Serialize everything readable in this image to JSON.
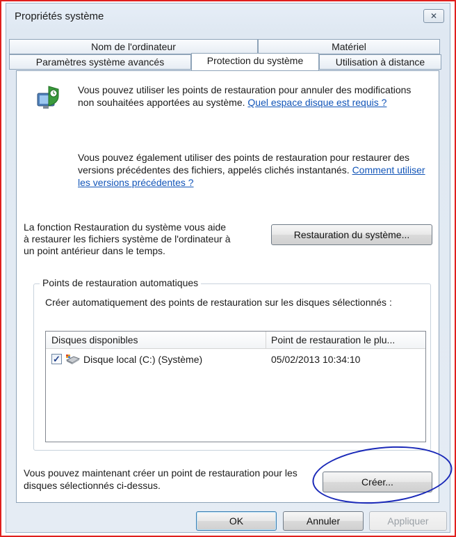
{
  "window": {
    "title": "Propriétés système",
    "close_glyph": "✕"
  },
  "tabs": {
    "back_row": [
      {
        "label": "Nom de l'ordinateur"
      },
      {
        "label": "Matériel"
      }
    ],
    "front_row": [
      {
        "label": "Paramètres système avancés"
      },
      {
        "label": "Protection du système",
        "active": true
      },
      {
        "label": "Utilisation à distance"
      }
    ]
  },
  "panel": {
    "icon": "system-restore-shield-icon",
    "intro": {
      "text": "Vous pouvez utiliser les points de restauration pour annuler des modifications non souhaitées apportées au système. ",
      "link": "Quel espace disque est requis ?"
    },
    "versions": {
      "text": "Vous pouvez également utiliser des points de restauration pour restaurer des versions précédentes des fichiers, appelés clichés instantanés. ",
      "link": "Comment utiliser les versions précédentes ?"
    },
    "restore": {
      "text": "La fonction Restauration du système vous aide à restaurer les fichiers système de l'ordinateur à un point antérieur dans le temps.",
      "button": "Restauration du système..."
    },
    "auto_points": {
      "label": "Points de restauration automatiques",
      "description": "Créer automatiquement des points de restauration sur les disques sélectionnés :",
      "columns": [
        "Disques disponibles",
        "Point de restauration le plu..."
      ],
      "disks": [
        {
          "name": "Disque local (C:) (Système)",
          "date": "05/02/2013 10:34:10",
          "checked": true
        }
      ]
    },
    "create": {
      "text": "Vous pouvez maintenant créer un point de restauration pour les disques sélectionnés ci-dessus.",
      "button": "Créer..."
    }
  },
  "footer": {
    "ok": "OK",
    "cancel": "Annuler",
    "apply": "Appliquer"
  },
  "colors": {
    "annotation_circle": "#1a29b8",
    "outer_border": "#e0201e",
    "link": "#1255b8"
  }
}
